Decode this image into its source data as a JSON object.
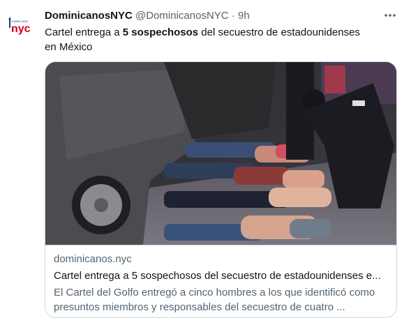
{
  "tweet": {
    "display_name": "DominicanosNYC",
    "handle": "@DominicanosNYC",
    "separator": "·",
    "time": "9h",
    "more_icon": "more-horizontal-icon",
    "text_before": "Cartel entrega a ",
    "text_bold": "5 sospechosos",
    "text_after": " del secuestro de estadounidenses en México"
  },
  "avatar": {
    "logo_text": "nyc",
    "logo_small_text": "DOMINICANOS"
  },
  "card": {
    "domain": "dominicanos.nyc",
    "title": "Cartel entrega a 5 sospechosos del secuestro de estadounidenses e...",
    "description": "El Cartel del Golfo entregó a cinco hombres a los que identificó como presuntos miembros y responsables del secuestro de cuatro ..."
  },
  "colors": {
    "text_primary": "#0f1419",
    "text_secondary": "#536471",
    "border": "#cfd9de",
    "logo_red": "#d6001c",
    "logo_blue": "#1d3b8b"
  }
}
